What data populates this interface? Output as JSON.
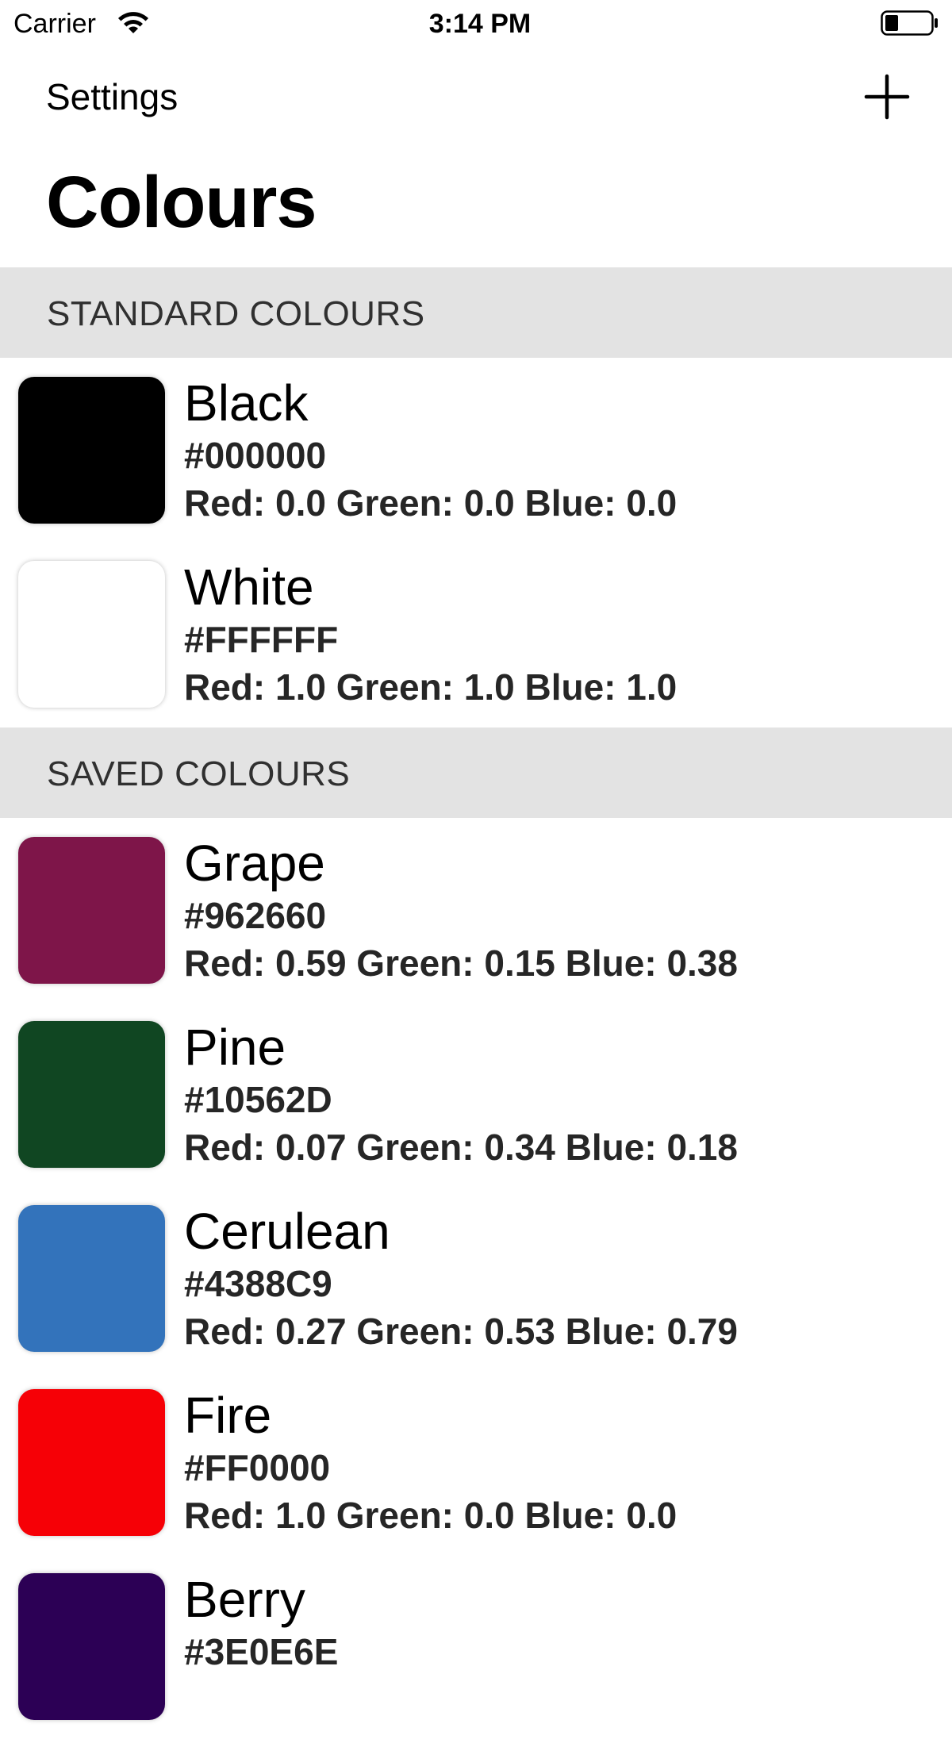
{
  "status_bar": {
    "carrier": "Carrier",
    "time": "3:14 PM"
  },
  "nav": {
    "back_label": "Settings",
    "add_icon": "plus-icon",
    "title": "Colours"
  },
  "sections": [
    {
      "header": "STANDARD COLOURS",
      "items": [
        {
          "name": "Black",
          "hex": "#000000",
          "rgb": "Red: 0.0 Green: 0.0 Blue: 0.0",
          "color": "#000000"
        },
        {
          "name": "White",
          "hex": "#FFFFFF",
          "rgb": "Red: 1.0 Green: 1.0 Blue: 1.0",
          "color": "#FFFFFF"
        }
      ]
    },
    {
      "header": "SAVED COLOURS",
      "items": [
        {
          "name": "Grape",
          "hex": "#962660",
          "rgb": "Red: 0.59 Green: 0.15 Blue: 0.38",
          "color": "#7E1549"
        },
        {
          "name": "Pine",
          "hex": "#10562D",
          "rgb": "Red: 0.07 Green: 0.34 Blue: 0.18",
          "color": "#104622"
        },
        {
          "name": "Cerulean",
          "hex": "#4388C9",
          "rgb": "Red: 0.27 Green: 0.53 Blue: 0.79",
          "color": "#3373BB"
        },
        {
          "name": "Fire",
          "hex": "#FF0000",
          "rgb": "Red: 1.0 Green: 0.0 Blue: 0.0",
          "color": "#F60006"
        },
        {
          "name": "Berry",
          "hex": "#3E0E6E",
          "rgb": "",
          "color": "#2C0055"
        }
      ]
    }
  ]
}
